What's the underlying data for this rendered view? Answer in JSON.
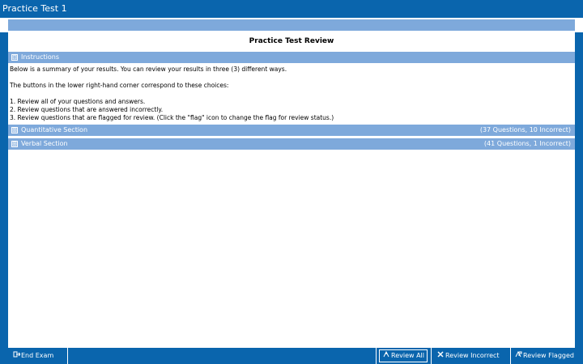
{
  "window": {
    "title": "Practice Test 1"
  },
  "review": {
    "title": "Practice Test Review"
  },
  "instructions": {
    "label": "Instructions",
    "expander": "⊟",
    "line1": "Below is a summary of your results. You can review your results in three (3) different ways.",
    "line2": "The buttons in the lower right-hand corner correspond to these choices:",
    "item1": "1. Review all of your questions and answers.",
    "item2": "2. Review questions that are answered incorrectly.",
    "item3": "3. Review questions that are flagged for review. (Click the \"flag\" icon to change the flag for review status.)"
  },
  "sections": [
    {
      "label": "Quantitative Section",
      "expander": "⊞",
      "summary": "(37 Questions, 10 Incorrect)"
    },
    {
      "label": "Verbal Section",
      "expander": "⊞",
      "summary": "(41 Questions, 1 Incorrect)"
    }
  ],
  "toolbar": {
    "end_exam": "End Exam",
    "review_all": "Review All",
    "review_incorrect": "Review Incorrect",
    "review_flagged": "Review Flagged"
  },
  "icons": {
    "end_exam": "exit-icon",
    "review_all": "review-icon",
    "review_incorrect": "x-icon",
    "review_flagged": "flag-review-icon"
  },
  "colors": {
    "frame": "#0a65ad",
    "section_bar": "#7ea9db"
  }
}
